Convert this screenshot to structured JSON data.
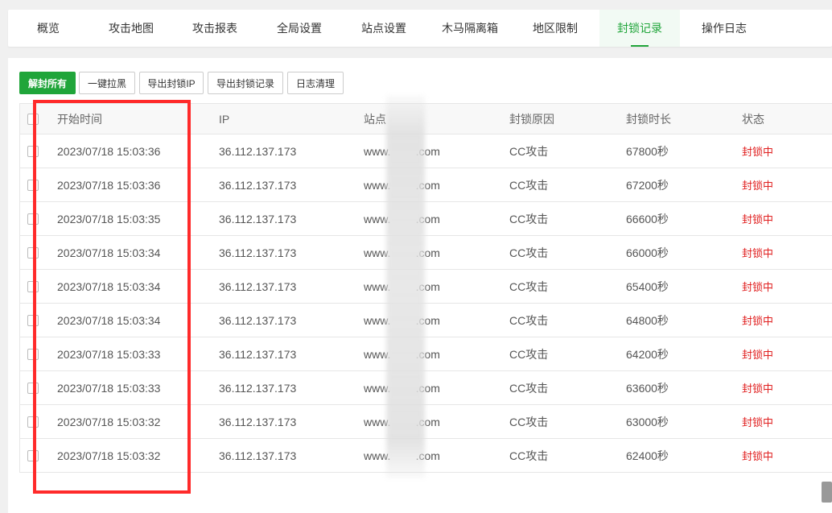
{
  "tabs": [
    {
      "label": "概览",
      "active": false
    },
    {
      "label": "攻击地图",
      "active": false
    },
    {
      "label": "攻击报表",
      "active": false
    },
    {
      "label": "全局设置",
      "active": false
    },
    {
      "label": "站点设置",
      "active": false
    },
    {
      "label": "木马隔离箱",
      "active": false
    },
    {
      "label": "地区限制",
      "active": false
    },
    {
      "label": "封锁记录",
      "active": true
    },
    {
      "label": "操作日志",
      "active": false
    }
  ],
  "toolbar": {
    "unblock_all": "解封所有",
    "one_click_blacklist": "一键拉黑",
    "export_blocked_ip": "导出封锁IP",
    "export_block_records": "导出封锁记录",
    "clear_log": "日志清理"
  },
  "table": {
    "columns": [
      "开始时间",
      "IP",
      "站点",
      "封锁原因",
      "封锁时长",
      "状态"
    ],
    "rows": [
      {
        "time": "2023/07/18 15:03:36",
        "ip": "36.112.137.173",
        "site": "www.        .com",
        "reason": "CC攻击",
        "duration": "67800秒",
        "status": "封锁中"
      },
      {
        "time": "2023/07/18 15:03:36",
        "ip": "36.112.137.173",
        "site": "www.        .com",
        "reason": "CC攻击",
        "duration": "67200秒",
        "status": "封锁中"
      },
      {
        "time": "2023/07/18 15:03:35",
        "ip": "36.112.137.173",
        "site": "www.        .com",
        "reason": "CC攻击",
        "duration": "66600秒",
        "status": "封锁中"
      },
      {
        "time": "2023/07/18 15:03:34",
        "ip": "36.112.137.173",
        "site": "www.        .com",
        "reason": "CC攻击",
        "duration": "66000秒",
        "status": "封锁中"
      },
      {
        "time": "2023/07/18 15:03:34",
        "ip": "36.112.137.173",
        "site": "www.        .com",
        "reason": "CC攻击",
        "duration": "65400秒",
        "status": "封锁中"
      },
      {
        "time": "2023/07/18 15:03:34",
        "ip": "36.112.137.173",
        "site": "www.        .com",
        "reason": "CC攻击",
        "duration": "64800秒",
        "status": "封锁中"
      },
      {
        "time": "2023/07/18 15:03:33",
        "ip": "36.112.137.173",
        "site": "www.        .com",
        "reason": "CC攻击",
        "duration": "64200秒",
        "status": "封锁中"
      },
      {
        "time": "2023/07/18 15:03:33",
        "ip": "36.112.137.173",
        "site": "www.        .com",
        "reason": "CC攻击",
        "duration": "63600秒",
        "status": "封锁中"
      },
      {
        "time": "2023/07/18 15:03:32",
        "ip": "36.112.137.173",
        "site": "www.        .com",
        "reason": "CC攻击",
        "duration": "63000秒",
        "status": "封锁中"
      },
      {
        "time": "2023/07/18 15:03:32",
        "ip": "36.112.137.173",
        "site": "www.        .com",
        "reason": "CC攻击",
        "duration": "62400秒",
        "status": "封锁中"
      }
    ]
  },
  "colors": {
    "accent": "#20a53a",
    "status_blocked": "#e02020",
    "annotation": "#ff2a2a"
  }
}
